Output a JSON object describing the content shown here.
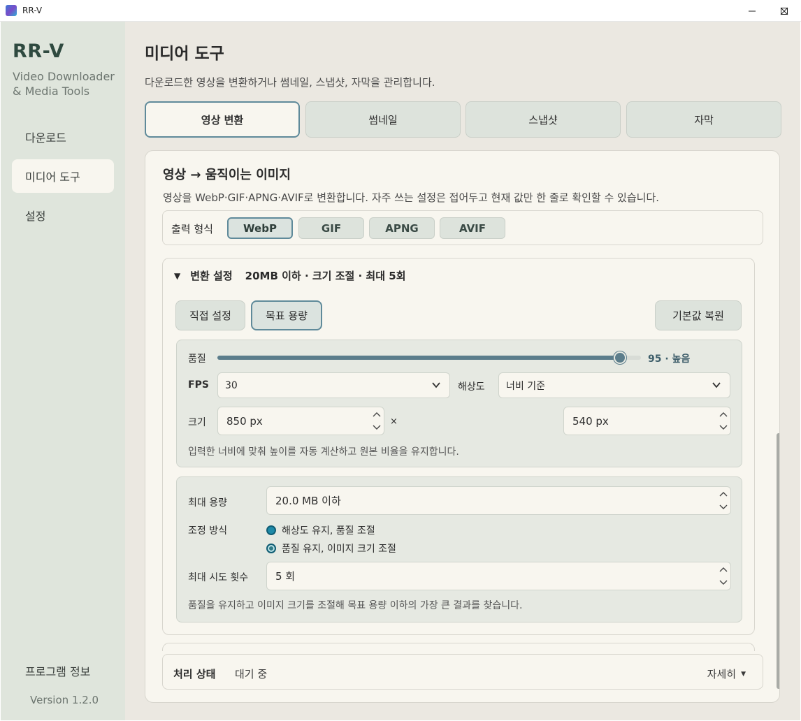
{
  "window": {
    "title": "RR-V"
  },
  "sidebar": {
    "brand": "RR-V",
    "brand_sub_1": "Video Downloader",
    "brand_sub_2": "& Media Tools",
    "items": [
      {
        "label": "다운로드"
      },
      {
        "label": "미디어 도구"
      },
      {
        "label": "설정"
      }
    ],
    "about": "프로그램 정보",
    "version": "Version 1.2.0"
  },
  "main": {
    "title": "미디어 도구",
    "desc": "다운로드한 영상을 변환하거나 썸네일, 스냅샷, 자막을 관리합니다.",
    "tabs": [
      {
        "label": "영상 변환"
      },
      {
        "label": "썸네일"
      },
      {
        "label": "스냅샷"
      },
      {
        "label": "자막"
      }
    ]
  },
  "card": {
    "title": "영상 → 움직이는 이미지",
    "desc": "영상을 WebP·GIF·APNG·AVIF로 변환합니다. 자주 쓰는 설정은 접어두고 현재 값만 한 줄로 확인할 수 있습니다.",
    "format_label": "출력 형식",
    "formats": [
      "WebP",
      "GIF",
      "APNG",
      "AVIF"
    ],
    "selected_format": "WebP"
  },
  "settings": {
    "title": "변환 설정",
    "summary": "20MB 이하 · 크기 조절 · 최대 5회",
    "mode_manual": "직접 설정",
    "mode_target": "목표 용량",
    "reset": "기본값 복원",
    "quality_label": "품질",
    "quality_value": 95,
    "quality_max": 100,
    "quality_text": "95 · 높음",
    "fps_label": "FPS",
    "fps_value": "30",
    "res_label": "해상도",
    "res_value": "너비 기준",
    "size_label": "크기",
    "width_value": "850 px",
    "times": "×",
    "height_value": "540 px",
    "size_hint": "입력한 너비에 맞춰 높이를 자동 계산하고 원본 비율을 유지합니다.",
    "max_size_label": "최대 용량",
    "max_size_value": "20.0 MB 이하",
    "adjust_label": "조정 방식",
    "adjust_opt1": "해상도 유지, 품질 조절",
    "adjust_opt2": "품질 유지, 이미지 크기 조절",
    "attempts_label": "최대 시도 횟수",
    "attempts_value": "5 회",
    "target_hint": "품질을 유지하고 이미지 크기를 조절해 목표 용량 이하의 가장 큰 결과를 찾습니다."
  },
  "status": {
    "label": "처리 상태",
    "value": "대기 중",
    "details": "자세히"
  },
  "colors": {
    "accent": "#5f8a9a",
    "sidebar_bg": "#dfe5dc",
    "main_bg": "#ebe8e1",
    "card_bg": "#f8f6ef"
  }
}
